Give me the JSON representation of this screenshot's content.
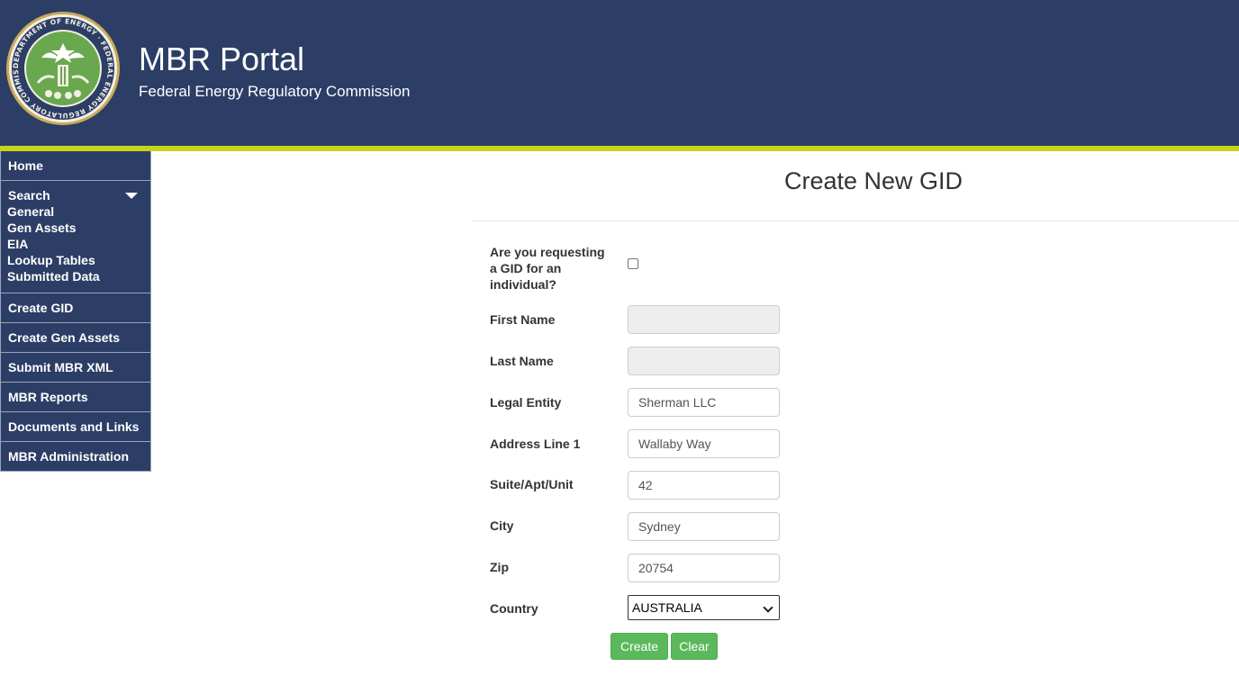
{
  "header": {
    "title": "MBR Portal",
    "subtitle": "Federal Energy Regulatory Commission",
    "seal_text": "DEPARTMENT OF ENERGY · FEDERAL ENERGY REGULATORY COMMISSION",
    "seal_icon": "ferc-seal",
    "colors": {
      "header_bg": "#2c3e66",
      "stripe": "#c6d51b"
    }
  },
  "sidebar": {
    "home": "Home",
    "search": {
      "label": "Search",
      "items": [
        "General",
        "Gen Assets",
        "EIA",
        "Lookup Tables",
        "Submitted Data"
      ]
    },
    "items": [
      "Create GID",
      "Create Gen Assets",
      "Submit MBR XML",
      "MBR Reports",
      "Documents and Links",
      "MBR Administration"
    ]
  },
  "main": {
    "title": "Create New GID",
    "form": {
      "individual_question": "Are you requesting a GID for an individual?",
      "individual_checked": false,
      "first_name": {
        "label": "First Name",
        "value": "",
        "disabled": true
      },
      "last_name": {
        "label": "Last Name",
        "value": "",
        "disabled": true
      },
      "legal_entity": {
        "label": "Legal Entity",
        "value": "Sherman LLC"
      },
      "address_line1": {
        "label": "Address Line 1",
        "value": "Wallaby Way"
      },
      "suite": {
        "label": "Suite/Apt/Unit",
        "value": "42"
      },
      "city": {
        "label": "City",
        "value": "Sydney"
      },
      "zip": {
        "label": "Zip",
        "value": "20754"
      },
      "country": {
        "label": "Country",
        "value": "AUSTRALIA"
      }
    },
    "buttons": {
      "create": "Create",
      "clear": "Clear",
      "color": "#5cb85c"
    }
  }
}
